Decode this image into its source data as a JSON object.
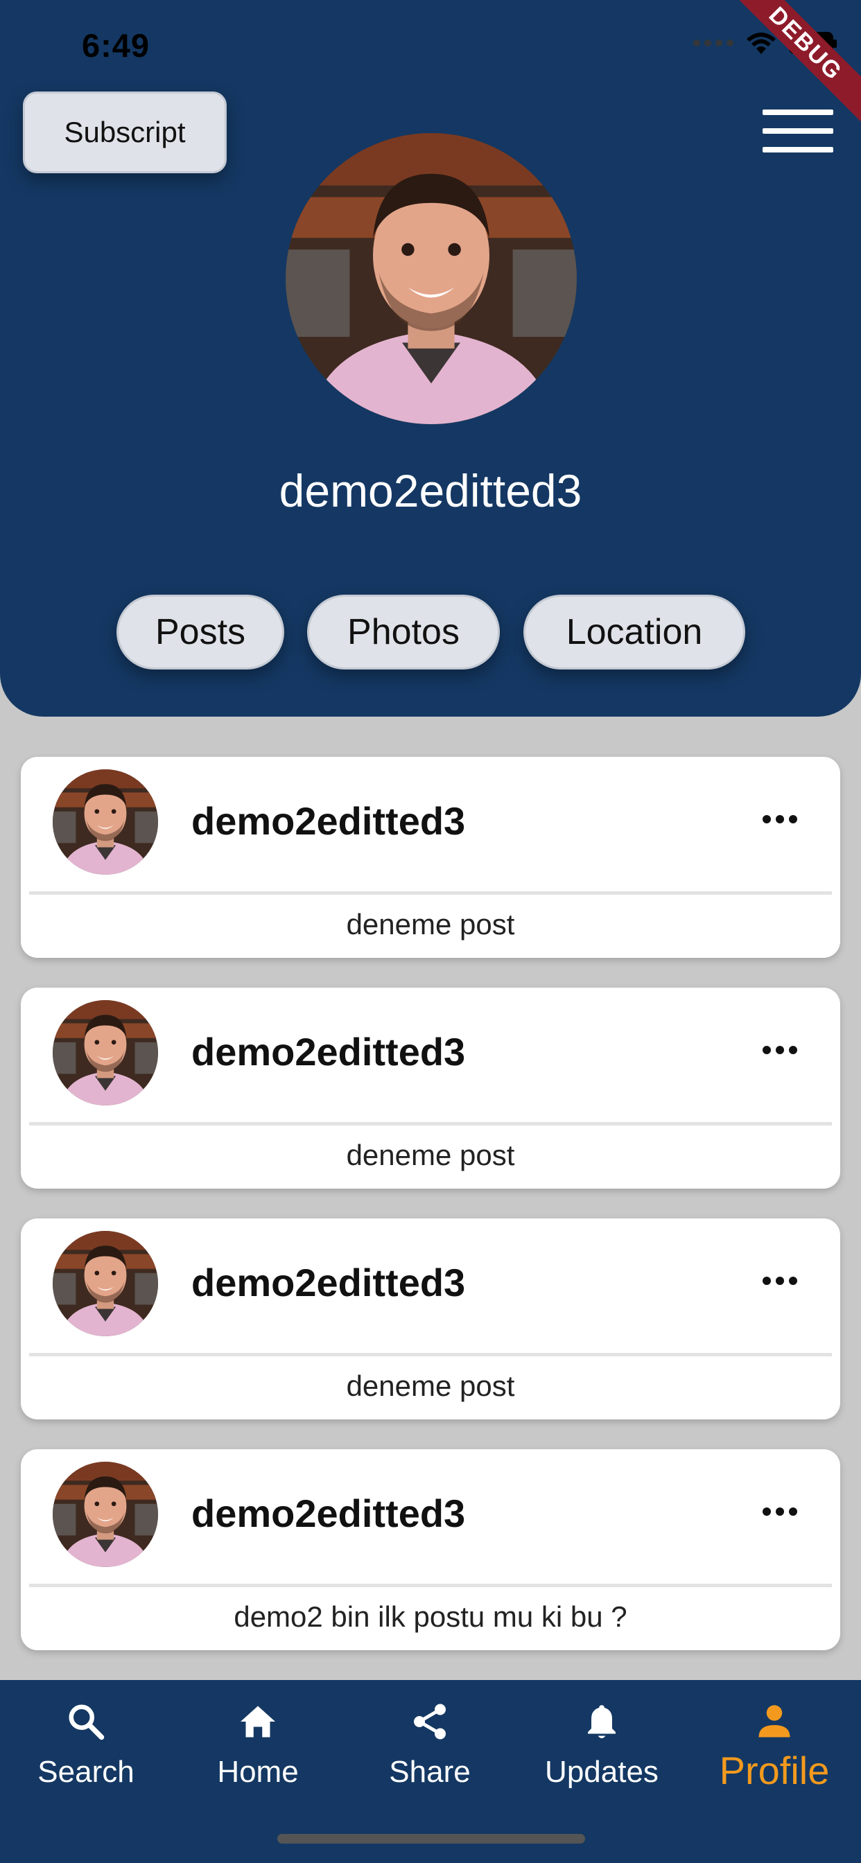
{
  "status_bar": {
    "time": "6:49",
    "debug_label": "DEBUG"
  },
  "header": {
    "subscript_label": "Subscript",
    "username": "demo2editted3",
    "tabs": [
      {
        "label": "Posts"
      },
      {
        "label": "Photos"
      },
      {
        "label": "Location"
      }
    ]
  },
  "posts": [
    {
      "author": "demo2editted3",
      "text": "deneme post"
    },
    {
      "author": "demo2editted3",
      "text": "deneme post"
    },
    {
      "author": "demo2editted3",
      "text": "deneme post"
    },
    {
      "author": "demo2editted3",
      "text": "demo2 bin ilk postu mu ki bu ?"
    }
  ],
  "bottom_nav": {
    "items": [
      {
        "label": "Search",
        "icon": "search-icon"
      },
      {
        "label": "Home",
        "icon": "home-icon"
      },
      {
        "label": "Share",
        "icon": "share-icon"
      },
      {
        "label": "Updates",
        "icon": "bell-icon"
      },
      {
        "label": "Profile",
        "icon": "person-icon",
        "active": true
      }
    ]
  },
  "colors": {
    "header_bg": "#143863",
    "accent": "#f39a1e",
    "page_bg": "#c8c8c8",
    "debug_ribbon": "#8e1b2a"
  }
}
